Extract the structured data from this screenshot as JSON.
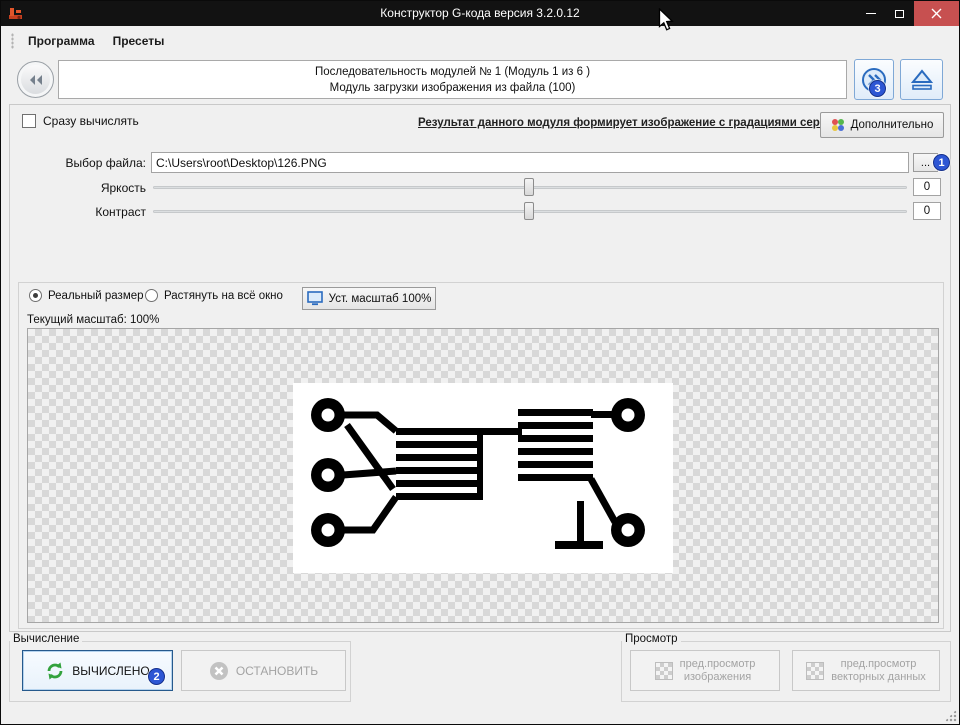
{
  "window": {
    "title": "Конструктор G-кода версия 3.2.0.12"
  },
  "menu": {
    "items": [
      {
        "label": "Программа"
      },
      {
        "label": "Пресеты"
      }
    ]
  },
  "nav": {
    "sequence_line1": "Последовательность модулей № 1 (Модуль 1 из 6 )",
    "sequence_line2": "Модуль загрузки изображения из файла (100)"
  },
  "module": {
    "auto_calc_label": "Сразу вычислять",
    "result_link": "Результат данного модуля формирует изображение с градациями серого",
    "advanced_label": "Дополнительно",
    "file_label": "Выбор файла:",
    "file_path": "C:\\Users\\root\\Desktop\\126.PNG",
    "browse_label": "...",
    "brightness_label": "Яркость",
    "brightness_value": "0",
    "contrast_label": "Контраст",
    "contrast_value": "0"
  },
  "preview": {
    "radio_real_label": "Реальный размер",
    "radio_stretch_label": "Растянуть на всё окно",
    "set_scale_label": "Уст. масштаб 100%",
    "current_scale_text": "Текущий масштаб: 100%"
  },
  "compute": {
    "group_label": "Вычисление",
    "computed_label": "ВЫЧИСЛЕНО",
    "stop_label": "ОСТАНОВИТЬ"
  },
  "view": {
    "group_label": "Просмотр",
    "preview_image_line1": "пред.просмотр",
    "preview_image_line2": "изображения",
    "preview_vector_line1": "пред.просмотр",
    "preview_vector_line2": "векторных данных"
  },
  "badges": [
    {
      "label": "1"
    },
    {
      "label": "2"
    },
    {
      "label": "3"
    }
  ],
  "colors": {
    "titlebar_bg": "#121212",
    "close_button": "#c75050",
    "badge_blue": "#2d56d4",
    "accent_blue": "#2a6bbf",
    "success_green": "#33a23d"
  }
}
